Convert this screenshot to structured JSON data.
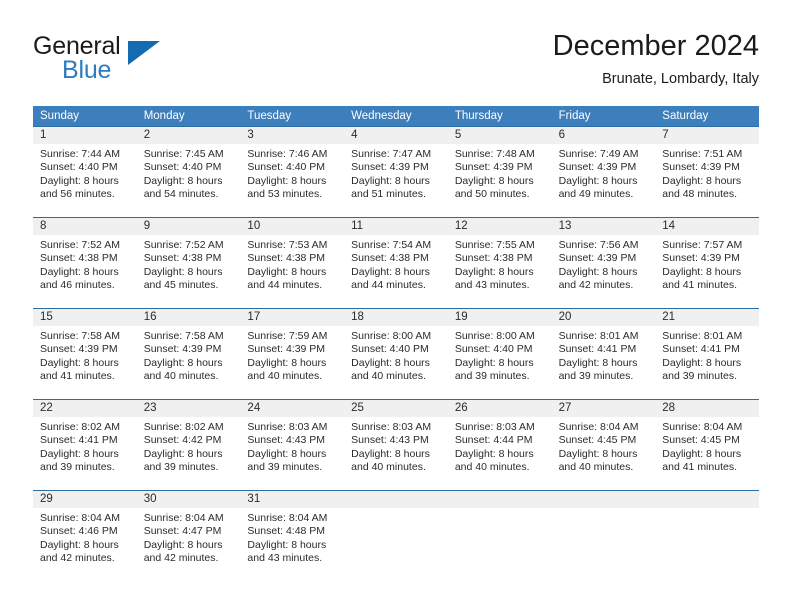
{
  "brand": {
    "name_part1": "General",
    "name_part2": "Blue",
    "logo_icon": "triangle-logo-icon"
  },
  "header": {
    "title": "December 2024",
    "location": "Brunate, Lombardy, Italy"
  },
  "calendar": {
    "weekdays": [
      "Sunday",
      "Monday",
      "Tuesday",
      "Wednesday",
      "Thursday",
      "Friday",
      "Saturday"
    ],
    "colors": {
      "header_blue": "#3d7ebd",
      "row_divider_blue": "#2e6da4",
      "daynum_band": "#f0f0f0",
      "brand_blue": "#2b7cc0",
      "logo_blue": "#136cb0",
      "text": "#2b2b2b"
    },
    "weeks": [
      [
        {
          "day": "1",
          "sunrise": "Sunrise: 7:44 AM",
          "sunset": "Sunset: 4:40 PM",
          "daylight_line1": "Daylight: 8 hours",
          "daylight_line2": "and 56 minutes."
        },
        {
          "day": "2",
          "sunrise": "Sunrise: 7:45 AM",
          "sunset": "Sunset: 4:40 PM",
          "daylight_line1": "Daylight: 8 hours",
          "daylight_line2": "and 54 minutes."
        },
        {
          "day": "3",
          "sunrise": "Sunrise: 7:46 AM",
          "sunset": "Sunset: 4:40 PM",
          "daylight_line1": "Daylight: 8 hours",
          "daylight_line2": "and 53 minutes."
        },
        {
          "day": "4",
          "sunrise": "Sunrise: 7:47 AM",
          "sunset": "Sunset: 4:39 PM",
          "daylight_line1": "Daylight: 8 hours",
          "daylight_line2": "and 51 minutes."
        },
        {
          "day": "5",
          "sunrise": "Sunrise: 7:48 AM",
          "sunset": "Sunset: 4:39 PM",
          "daylight_line1": "Daylight: 8 hours",
          "daylight_line2": "and 50 minutes."
        },
        {
          "day": "6",
          "sunrise": "Sunrise: 7:49 AM",
          "sunset": "Sunset: 4:39 PM",
          "daylight_line1": "Daylight: 8 hours",
          "daylight_line2": "and 49 minutes."
        },
        {
          "day": "7",
          "sunrise": "Sunrise: 7:51 AM",
          "sunset": "Sunset: 4:39 PM",
          "daylight_line1": "Daylight: 8 hours",
          "daylight_line2": "and 48 minutes."
        }
      ],
      [
        {
          "day": "8",
          "sunrise": "Sunrise: 7:52 AM",
          "sunset": "Sunset: 4:38 PM",
          "daylight_line1": "Daylight: 8 hours",
          "daylight_line2": "and 46 minutes."
        },
        {
          "day": "9",
          "sunrise": "Sunrise: 7:52 AM",
          "sunset": "Sunset: 4:38 PM",
          "daylight_line1": "Daylight: 8 hours",
          "daylight_line2": "and 45 minutes."
        },
        {
          "day": "10",
          "sunrise": "Sunrise: 7:53 AM",
          "sunset": "Sunset: 4:38 PM",
          "daylight_line1": "Daylight: 8 hours",
          "daylight_line2": "and 44 minutes."
        },
        {
          "day": "11",
          "sunrise": "Sunrise: 7:54 AM",
          "sunset": "Sunset: 4:38 PM",
          "daylight_line1": "Daylight: 8 hours",
          "daylight_line2": "and 44 minutes."
        },
        {
          "day": "12",
          "sunrise": "Sunrise: 7:55 AM",
          "sunset": "Sunset: 4:38 PM",
          "daylight_line1": "Daylight: 8 hours",
          "daylight_line2": "and 43 minutes."
        },
        {
          "day": "13",
          "sunrise": "Sunrise: 7:56 AM",
          "sunset": "Sunset: 4:39 PM",
          "daylight_line1": "Daylight: 8 hours",
          "daylight_line2": "and 42 minutes."
        },
        {
          "day": "14",
          "sunrise": "Sunrise: 7:57 AM",
          "sunset": "Sunset: 4:39 PM",
          "daylight_line1": "Daylight: 8 hours",
          "daylight_line2": "and 41 minutes."
        }
      ],
      [
        {
          "day": "15",
          "sunrise": "Sunrise: 7:58 AM",
          "sunset": "Sunset: 4:39 PM",
          "daylight_line1": "Daylight: 8 hours",
          "daylight_line2": "and 41 minutes."
        },
        {
          "day": "16",
          "sunrise": "Sunrise: 7:58 AM",
          "sunset": "Sunset: 4:39 PM",
          "daylight_line1": "Daylight: 8 hours",
          "daylight_line2": "and 40 minutes."
        },
        {
          "day": "17",
          "sunrise": "Sunrise: 7:59 AM",
          "sunset": "Sunset: 4:39 PM",
          "daylight_line1": "Daylight: 8 hours",
          "daylight_line2": "and 40 minutes."
        },
        {
          "day": "18",
          "sunrise": "Sunrise: 8:00 AM",
          "sunset": "Sunset: 4:40 PM",
          "daylight_line1": "Daylight: 8 hours",
          "daylight_line2": "and 40 minutes."
        },
        {
          "day": "19",
          "sunrise": "Sunrise: 8:00 AM",
          "sunset": "Sunset: 4:40 PM",
          "daylight_line1": "Daylight: 8 hours",
          "daylight_line2": "and 39 minutes."
        },
        {
          "day": "20",
          "sunrise": "Sunrise: 8:01 AM",
          "sunset": "Sunset: 4:41 PM",
          "daylight_line1": "Daylight: 8 hours",
          "daylight_line2": "and 39 minutes."
        },
        {
          "day": "21",
          "sunrise": "Sunrise: 8:01 AM",
          "sunset": "Sunset: 4:41 PM",
          "daylight_line1": "Daylight: 8 hours",
          "daylight_line2": "and 39 minutes."
        }
      ],
      [
        {
          "day": "22",
          "sunrise": "Sunrise: 8:02 AM",
          "sunset": "Sunset: 4:41 PM",
          "daylight_line1": "Daylight: 8 hours",
          "daylight_line2": "and 39 minutes."
        },
        {
          "day": "23",
          "sunrise": "Sunrise: 8:02 AM",
          "sunset": "Sunset: 4:42 PM",
          "daylight_line1": "Daylight: 8 hours",
          "daylight_line2": "and 39 minutes."
        },
        {
          "day": "24",
          "sunrise": "Sunrise: 8:03 AM",
          "sunset": "Sunset: 4:43 PM",
          "daylight_line1": "Daylight: 8 hours",
          "daylight_line2": "and 39 minutes."
        },
        {
          "day": "25",
          "sunrise": "Sunrise: 8:03 AM",
          "sunset": "Sunset: 4:43 PM",
          "daylight_line1": "Daylight: 8 hours",
          "daylight_line2": "and 40 minutes."
        },
        {
          "day": "26",
          "sunrise": "Sunrise: 8:03 AM",
          "sunset": "Sunset: 4:44 PM",
          "daylight_line1": "Daylight: 8 hours",
          "daylight_line2": "and 40 minutes."
        },
        {
          "day": "27",
          "sunrise": "Sunrise: 8:04 AM",
          "sunset": "Sunset: 4:45 PM",
          "daylight_line1": "Daylight: 8 hours",
          "daylight_line2": "and 40 minutes."
        },
        {
          "day": "28",
          "sunrise": "Sunrise: 8:04 AM",
          "sunset": "Sunset: 4:45 PM",
          "daylight_line1": "Daylight: 8 hours",
          "daylight_line2": "and 41 minutes."
        }
      ],
      [
        {
          "day": "29",
          "sunrise": "Sunrise: 8:04 AM",
          "sunset": "Sunset: 4:46 PM",
          "daylight_line1": "Daylight: 8 hours",
          "daylight_line2": "and 42 minutes."
        },
        {
          "day": "30",
          "sunrise": "Sunrise: 8:04 AM",
          "sunset": "Sunset: 4:47 PM",
          "daylight_line1": "Daylight: 8 hours",
          "daylight_line2": "and 42 minutes."
        },
        {
          "day": "31",
          "sunrise": "Sunrise: 8:04 AM",
          "sunset": "Sunset: 4:48 PM",
          "daylight_line1": "Daylight: 8 hours",
          "daylight_line2": "and 43 minutes."
        },
        {
          "day": "",
          "sunrise": "",
          "sunset": "",
          "daylight_line1": "",
          "daylight_line2": ""
        },
        {
          "day": "",
          "sunrise": "",
          "sunset": "",
          "daylight_line1": "",
          "daylight_line2": ""
        },
        {
          "day": "",
          "sunrise": "",
          "sunset": "",
          "daylight_line1": "",
          "daylight_line2": ""
        },
        {
          "day": "",
          "sunrise": "",
          "sunset": "",
          "daylight_line1": "",
          "daylight_line2": ""
        }
      ]
    ]
  }
}
